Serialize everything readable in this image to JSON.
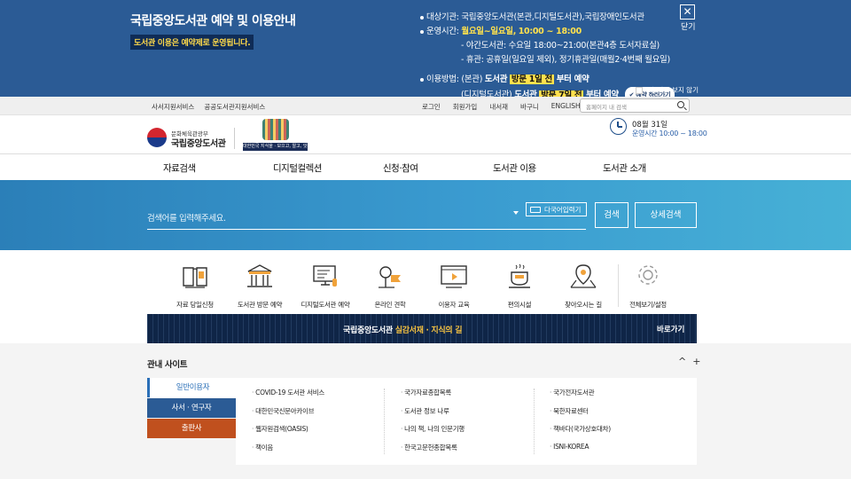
{
  "banner": {
    "title": "국립중앙도서관 예약 및 이용안내",
    "subtitle": "도서관 이용은 예약제로 운영됩니다.",
    "target_label": "대상기관:",
    "target_value": "국립중앙도서관(본관,디지털도서관),국립장애인도서관",
    "hours_label": "운영시간:",
    "hours_days": "월요일~일요일,",
    "hours_time": "10:00 ~ 18:00",
    "night_line": "- 야간도서관: 수요일 18:00~21:00(본관4층 도서자료실)",
    "closed_line": "- 휴관: 공휴일(일요일 제외), 정기휴관일(매월2·4번째 월요일)",
    "usage_label": "이용방법:",
    "usage_main_prefix": "(본관)",
    "usage_main_lib": "도서관",
    "usage_main_box": "방문 1일 전",
    "usage_main_suffix": "부터 예약",
    "usage_digital_prefix": "(디지털도서관)",
    "usage_digital_lib": "도서관",
    "usage_digital_box": "방문 7일 전",
    "usage_digital_suffix": "부터 예약",
    "reserve_button": "✔ 예약 하러가기",
    "close_label": "닫기",
    "no_show_label": "오늘하루 보지 않기"
  },
  "utility": {
    "left_links": [
      "사서지원서비스",
      "공공도서관지원서비스"
    ],
    "right_links": [
      "로그인",
      "회원가입",
      "내서재",
      "바구니",
      "ENGLISH"
    ],
    "search_placeholder": "홈페이지 내 검색"
  },
  "header": {
    "ministry": "문화체육관광부",
    "library_name": "국립중앙도서관",
    "campaign_tag": "대한민국 지식을 · 모으고, 알고, 잇다",
    "date": "08월 31일",
    "hours": "운영시간 10:00 ~ 18:00"
  },
  "gnb": [
    "자료검색",
    "디지털컬렉션",
    "신청·참여",
    "도서관 이용",
    "도서관 소개"
  ],
  "search": {
    "placeholder": "검색어를 입력해주세요.",
    "multilang_button": "다국어입력기",
    "search_button": "검색",
    "advanced_button": "상세검색"
  },
  "quick_menu": [
    {
      "label": "자료 당일신청",
      "icon": "book-request-icon"
    },
    {
      "label": "도서관 방문 예약",
      "icon": "library-building-icon"
    },
    {
      "label": "디지털도서관 예약",
      "icon": "computer-icon"
    },
    {
      "label": "온라인 견학",
      "icon": "flag-pin-icon"
    },
    {
      "label": "이용자 교육",
      "icon": "video-lecture-icon"
    },
    {
      "label": "편의시설",
      "icon": "coffee-cup-icon"
    },
    {
      "label": "찾아오시는 길",
      "icon": "map-pin-icon"
    },
    {
      "label": "전체보기/설정",
      "icon": "gear-icon"
    }
  ],
  "promo": {
    "text_prefix": "국립중앙도서관",
    "text_highlight": "실감서재 · 지식의 길",
    "go_label": "바로가기"
  },
  "related": {
    "title": "관내 사이트",
    "controls": [
      "^",
      "+"
    ],
    "tabs": [
      "일반이용자",
      "사서 · 연구자",
      "출판사"
    ],
    "columns": [
      [
        "COVID-19 도서관 서비스",
        "대한민국신문아카이브",
        "웹자원검색(OASIS)",
        "책이음"
      ],
      [
        "국가자료종합목록",
        "도서관 정보 나루",
        "나의 책, 나의 인문기행",
        "한국고문헌종합목록"
      ],
      [
        "국가전자도서관",
        "북한자료센터",
        "책바다(국가상호대차)",
        "ISNI-KOREA"
      ]
    ]
  }
}
